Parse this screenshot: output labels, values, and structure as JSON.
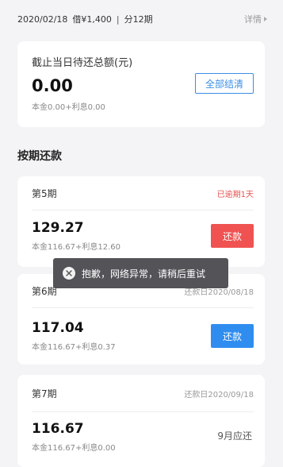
{
  "header": {
    "date": "2020/02/18",
    "loan": "借¥1,400",
    "separator": "|",
    "installments": "分12期",
    "details_label": "详情"
  },
  "summary": {
    "title": "截止当日待还总额(元)",
    "amount": "0.00",
    "breakdown": "本金0.00+利息0.00",
    "settle_all_label": "全部结清"
  },
  "section_title": "按期还款",
  "periods": [
    {
      "name": "第5期",
      "status": "已逾期1天",
      "amount": "129.27",
      "breakdown": "本金116.67+利息12.60",
      "action_label": "还款"
    },
    {
      "name": "第6期",
      "status": "还款日2020/08/18",
      "amount": "117.04",
      "breakdown": "本金116.67+利息0.37",
      "action_label": "还款"
    },
    {
      "name": "第7期",
      "status": "还款日2020/09/18",
      "amount": "116.67",
      "breakdown": "本金116.67+利息0.00",
      "due_note": "9月应还"
    }
  ],
  "toast": {
    "message": "抱歉，网络异常，请稍后重试"
  },
  "colors": {
    "accent_blue": "#2f8df0",
    "overdue_red": "#f05252",
    "background": "#f4f4f6"
  }
}
